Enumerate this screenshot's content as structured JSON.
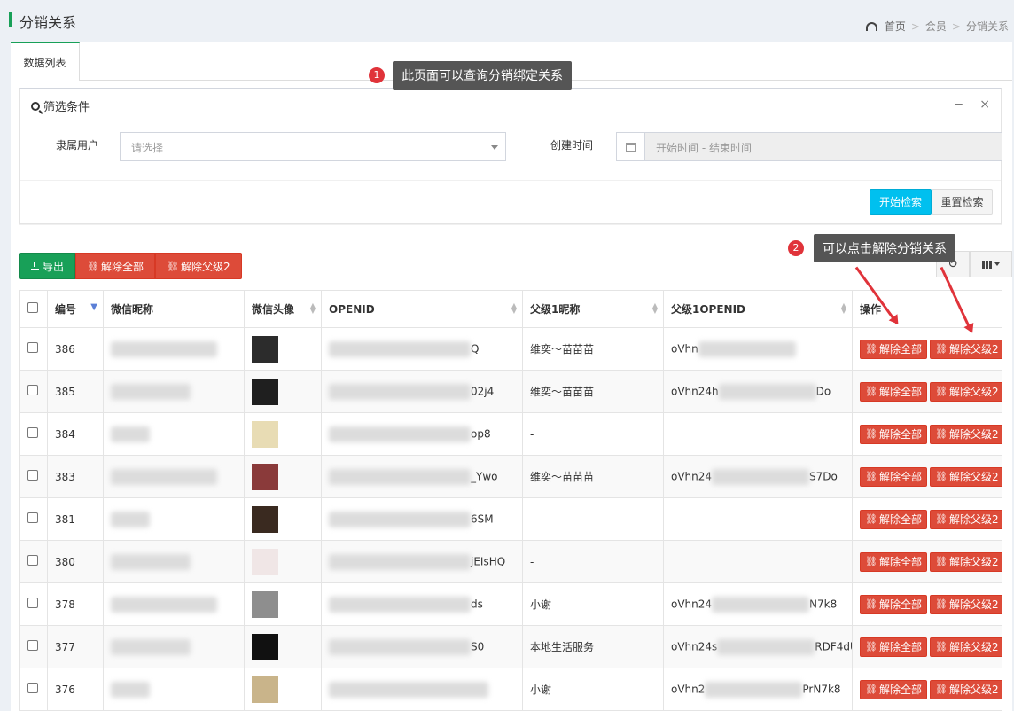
{
  "header": {
    "title": "分销关系",
    "breadcrumb": [
      "首页",
      "会员",
      "分销关系"
    ]
  },
  "tab": "数据列表",
  "tips": [
    {
      "num": "1",
      "text": "此页面可以查询分销绑定关系"
    },
    {
      "num": "2",
      "text": "可以点击解除分销关系"
    }
  ],
  "filter": {
    "title": "筛选条件",
    "minimize": "−",
    "close": "×",
    "user_label": "隶属用户",
    "user_placeholder": "请选择",
    "time_label": "创建时间",
    "time_placeholder": "开始时间 - 结束时间",
    "search_btn": "开始检索",
    "reset_btn": "重置检索"
  },
  "toolbar": {
    "export": "导出",
    "remove_all": "解除全部",
    "remove_parent2": "解除父级2"
  },
  "table": {
    "columns": [
      "编号",
      "微信昵称",
      "微信头像",
      "OPENID",
      "父级1昵称",
      "父级1OPENID",
      "操作"
    ],
    "rows": [
      {
        "id": "386",
        "openid": "Q",
        "parent1": "维奕～苗苗苗",
        "parent_openid": "oVhn",
        "avatar": "#2c2c2c"
      },
      {
        "id": "385",
        "openid": "02j4",
        "parent1": "维奕～苗苗苗",
        "parent_openid": "oVhn24h",
        "parent_openid_tail": "Do",
        "avatar": "#1f1f1f"
      },
      {
        "id": "384",
        "openid": "op8",
        "parent1": "-",
        "parent_openid": "",
        "avatar": "#e8dcb4"
      },
      {
        "id": "383",
        "openid": "_Ywo",
        "parent1": "维奕～苗苗苗",
        "parent_openid": "oVhn24",
        "parent_openid_tail": "S7Do",
        "avatar": "#8a3a3a"
      },
      {
        "id": "381",
        "openid": "6SM",
        "parent1": "-",
        "parent_openid": "",
        "avatar": "#3a2a20"
      },
      {
        "id": "380",
        "openid": "jEIsHQ",
        "parent1": "-",
        "parent_openid": "",
        "avatar": "#f0e6e6"
      },
      {
        "id": "378",
        "openid": "ds",
        "parent1": "小谢",
        "parent_openid": "oVhn24",
        "parent_openid_tail": "N7k8",
        "avatar": "#8e8e8e"
      },
      {
        "id": "377",
        "openid": "S0",
        "parent1": "本地生活服务",
        "parent_openid": "oVhn24s",
        "parent_openid_tail": "RDF4dU",
        "avatar": "#111111"
      },
      {
        "id": "376",
        "openid": "",
        "parent1": "小谢",
        "parent_openid": "oVhn2",
        "parent_openid_tail": "PrN7k8",
        "avatar": "#c9b48a"
      }
    ],
    "op_remove_all": "解除全部",
    "op_remove_parent2": "解除父级2"
  },
  "colors": {
    "accent": "#18a058",
    "danger": "#dd4b39",
    "info": "#00c0ef",
    "marker": "#e0333a"
  }
}
